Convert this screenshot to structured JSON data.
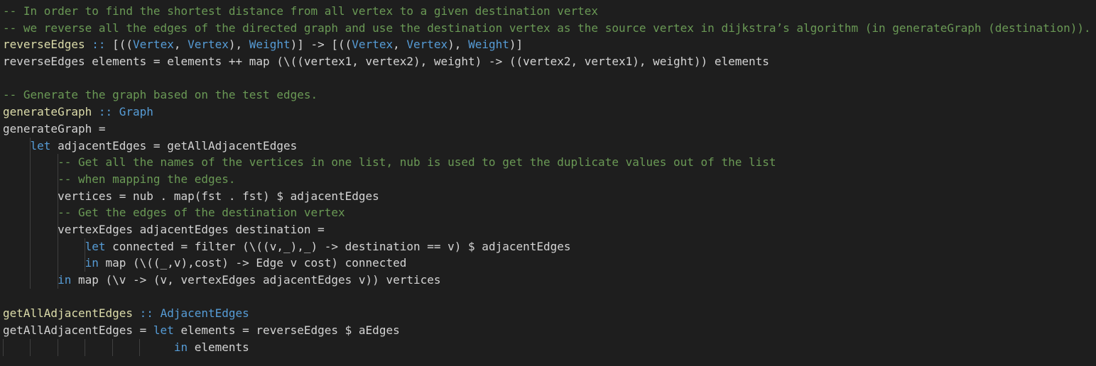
{
  "editor": {
    "background": "#1e1e1e",
    "colors": {
      "comment": "#6a9955",
      "function": "#dcdcaa",
      "type": "#569cd6",
      "keyword": "#569cd6",
      "plain": "#d4d4d4",
      "indent_guide": "#404040"
    },
    "lines": [
      [
        {
          "t": "comment",
          "s": "-- In order to find the shortest distance from all vertex to a given destination vertex"
        }
      ],
      [
        {
          "t": "comment",
          "s": "-- we reverse all the edges of the directed graph and use the destination vertex as the source vertex in dijkstra’s algorithm (in generateGraph (destination))."
        }
      ],
      [
        {
          "t": "func",
          "s": "reverseEdges"
        },
        {
          "t": "plain",
          "s": " "
        },
        {
          "t": "type",
          "s": "::"
        },
        {
          "t": "plain",
          "s": " [(("
        },
        {
          "t": "type",
          "s": "Vertex"
        },
        {
          "t": "plain",
          "s": ", "
        },
        {
          "t": "type",
          "s": "Vertex"
        },
        {
          "t": "plain",
          "s": "), "
        },
        {
          "t": "type",
          "s": "Weight"
        },
        {
          "t": "plain",
          "s": ")] -> [(("
        },
        {
          "t": "type",
          "s": "Vertex"
        },
        {
          "t": "plain",
          "s": ", "
        },
        {
          "t": "type",
          "s": "Vertex"
        },
        {
          "t": "plain",
          "s": "), "
        },
        {
          "t": "type",
          "s": "Weight"
        },
        {
          "t": "plain",
          "s": ")]"
        }
      ],
      [
        {
          "t": "plain",
          "s": "reverseEdges elements = elements ++ map (\\((vertex1, vertex2), weight) -> ((vertex2, vertex1), weight)) elements"
        }
      ],
      [],
      [
        {
          "t": "comment",
          "s": "-- Generate the graph based on the test edges."
        }
      ],
      [
        {
          "t": "func",
          "s": "generateGraph"
        },
        {
          "t": "plain",
          "s": " "
        },
        {
          "t": "type",
          "s": ":: Graph"
        }
      ],
      [
        {
          "t": "plain",
          "s": "generateGraph ="
        }
      ],
      [
        {
          "t": "plain",
          "s": "    "
        },
        {
          "t": "keyword",
          "s": "let"
        },
        {
          "t": "plain",
          "s": " adjacentEdges = getAllAdjacentEdges"
        }
      ],
      [
        {
          "t": "plain",
          "s": "        "
        },
        {
          "t": "comment",
          "s": "-- Get all the names of the vertices in one list, nub is used to get the duplicate values out of the list"
        }
      ],
      [
        {
          "t": "plain",
          "s": "        "
        },
        {
          "t": "comment",
          "s": "-- when mapping the edges."
        }
      ],
      [
        {
          "t": "plain",
          "s": "        vertices = nub . map(fst . fst) $ adjacentEdges"
        }
      ],
      [
        {
          "t": "plain",
          "s": "        "
        },
        {
          "t": "comment",
          "s": "-- Get the edges of the destination vertex"
        }
      ],
      [
        {
          "t": "plain",
          "s": "        vertexEdges adjacentEdges destination ="
        }
      ],
      [
        {
          "t": "plain",
          "s": "            "
        },
        {
          "t": "keyword",
          "s": "let"
        },
        {
          "t": "plain",
          "s": " connected = filter (\\((v,_),_) -> destination == v) $ adjacentEdges"
        }
      ],
      [
        {
          "t": "plain",
          "s": "            "
        },
        {
          "t": "keyword",
          "s": "in"
        },
        {
          "t": "plain",
          "s": " map (\\((_,v),cost) -> Edge v cost) connected"
        }
      ],
      [
        {
          "t": "plain",
          "s": "        "
        },
        {
          "t": "keyword",
          "s": "in"
        },
        {
          "t": "plain",
          "s": " map (\\v -> (v, vertexEdges adjacentEdges v)) vertices"
        }
      ],
      [],
      [
        {
          "t": "func",
          "s": "getAllAdjacentEdges"
        },
        {
          "t": "plain",
          "s": " "
        },
        {
          "t": "type",
          "s": ":: AdjacentEdges"
        }
      ],
      [
        {
          "t": "plain",
          "s": "getAllAdjacentEdges = "
        },
        {
          "t": "keyword",
          "s": "let"
        },
        {
          "t": "plain",
          "s": " elements = reverseEdges $ aEdges"
        }
      ],
      [
        {
          "t": "plain",
          "s": "                         "
        },
        {
          "t": "keyword",
          "s": "in"
        },
        {
          "t": "plain",
          "s": " elements"
        }
      ]
    ]
  }
}
